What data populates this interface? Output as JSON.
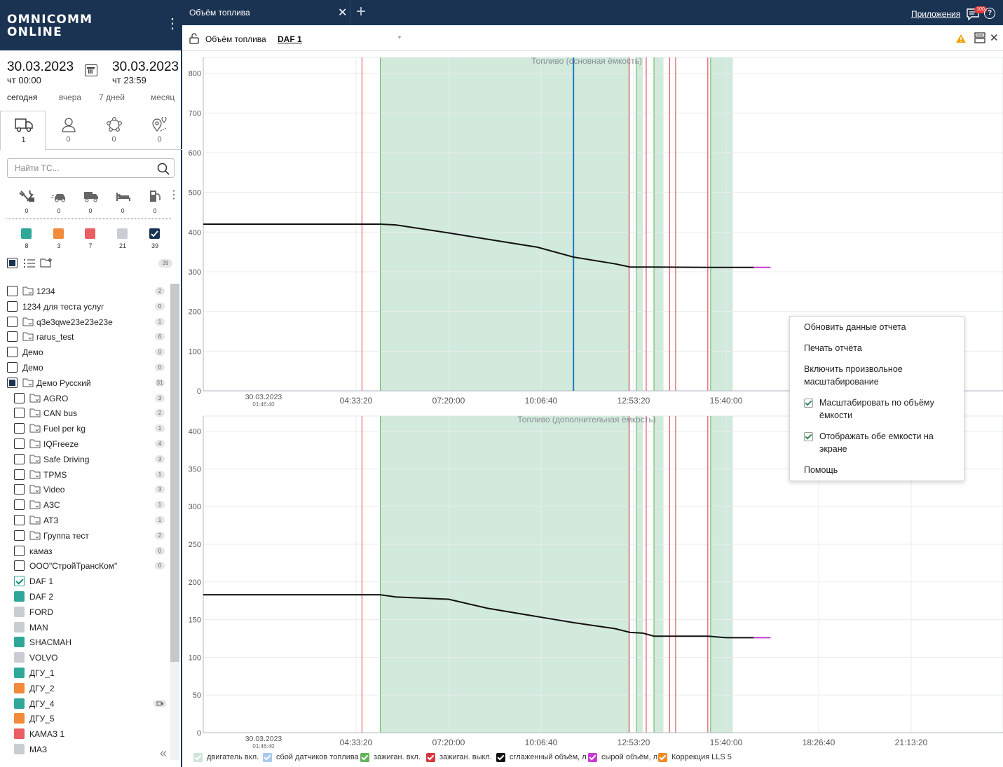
{
  "brand": {
    "line1": "OMNICOMM",
    "line2": "ONLINE"
  },
  "period": {
    "from_date": "30.03.2023",
    "from_time": "чт 00:00",
    "to_date": "30.03.2023",
    "to_time": "чт 23:59",
    "quick": [
      "сегодня",
      "вчера",
      "7 дней",
      "месяц"
    ]
  },
  "entity_tabs": [
    {
      "icon": "truck-icon",
      "count": "1"
    },
    {
      "icon": "user-icon",
      "count": "0"
    },
    {
      "icon": "network-icon",
      "count": "0"
    },
    {
      "icon": "geozone-icon",
      "count": "0"
    }
  ],
  "search": {
    "placeholder": "Найти ТС..."
  },
  "status_filters": [
    {
      "icon": "service-icon",
      "count": "0"
    },
    {
      "icon": "car-moving-icon",
      "count": "0"
    },
    {
      "icon": "truck-parked-icon",
      "count": "0"
    },
    {
      "icon": "bed-icon",
      "count": "0"
    },
    {
      "icon": "fuel-station-icon",
      "count": "0"
    }
  ],
  "color_filters": [
    {
      "color": "#2fa89a",
      "count": "8"
    },
    {
      "color": "#f28a3c",
      "count": "3"
    },
    {
      "color": "#ea5d62",
      "count": "7"
    },
    {
      "color": "#c9cdd3",
      "count": "21"
    },
    {
      "color": "#1b3352",
      "count": "39",
      "checked": true
    }
  ],
  "total_count": "39",
  "tree": [
    {
      "label": "1234",
      "count": "2",
      "folder": true,
      "level": 0,
      "state": "none"
    },
    {
      "label": "1234 для теста услуг",
      "count": "0",
      "folder": false,
      "level": 0,
      "state": "none"
    },
    {
      "label": "q3e3qwe23e23e23e",
      "count": "1",
      "folder": true,
      "level": 0,
      "state": "none"
    },
    {
      "label": "rarus_test",
      "count": "6",
      "folder": true,
      "level": 0,
      "state": "none"
    },
    {
      "label": "Демо",
      "count": "0",
      "folder": false,
      "level": 0,
      "state": "none"
    },
    {
      "label": "Демо",
      "count": "0",
      "folder": false,
      "level": 0,
      "state": "none"
    },
    {
      "label": "Демо Русский",
      "count": "31",
      "folder": true,
      "level": 0,
      "state": "partial"
    },
    {
      "label": "AGRO",
      "count": "3",
      "folder": true,
      "level": 1,
      "state": "none"
    },
    {
      "label": "CAN bus",
      "count": "2",
      "folder": true,
      "level": 1,
      "state": "none"
    },
    {
      "label": "Fuel per kg",
      "count": "1",
      "folder": true,
      "level": 1,
      "state": "none"
    },
    {
      "label": "IQFreeze",
      "count": "4",
      "folder": true,
      "level": 1,
      "state": "none"
    },
    {
      "label": "Safe Driving",
      "count": "3",
      "folder": true,
      "level": 1,
      "state": "none"
    },
    {
      "label": "TPMS",
      "count": "1",
      "folder": true,
      "level": 1,
      "state": "none"
    },
    {
      "label": "Video",
      "count": "3",
      "folder": true,
      "level": 1,
      "state": "none"
    },
    {
      "label": "АЗС",
      "count": "1",
      "folder": true,
      "level": 1,
      "state": "none"
    },
    {
      "label": "АТЗ",
      "count": "1",
      "folder": true,
      "level": 1,
      "state": "none"
    },
    {
      "label": "Группа тест",
      "count": "2",
      "folder": true,
      "level": 1,
      "state": "none"
    },
    {
      "label": "камаз",
      "count": "0",
      "folder": false,
      "level": 1,
      "state": "none"
    },
    {
      "label": "ООО\"СтройТрансКом\"",
      "count": "0",
      "folder": false,
      "level": 1,
      "state": "none"
    },
    {
      "label": "DAF 1",
      "color": "#2fa89a",
      "level": 1,
      "state": "checked"
    },
    {
      "label": "DAF 2",
      "color": "#2fa89a",
      "level": 1,
      "state": "color"
    },
    {
      "label": "FORD",
      "color": "#c9cdd3",
      "level": 1,
      "state": "color"
    },
    {
      "label": "MAN",
      "color": "#c9cdd3",
      "level": 1,
      "state": "color"
    },
    {
      "label": "SHACMAH",
      "color": "#2fa89a",
      "level": 1,
      "state": "color"
    },
    {
      "label": "VOLVO",
      "color": "#c9cdd3",
      "level": 1,
      "state": "color"
    },
    {
      "label": "ДГУ_1",
      "color": "#2fa89a",
      "level": 1,
      "state": "color"
    },
    {
      "label": "ДГУ_2",
      "color": "#f28a3c",
      "level": 1,
      "state": "color"
    },
    {
      "label": "ДГУ_4",
      "color": "#2fa89a",
      "level": 1,
      "state": "color",
      "video": true
    },
    {
      "label": "ДГУ_5",
      "color": "#f28a3c",
      "level": 1,
      "state": "color"
    },
    {
      "label": "КАМАЗ 1",
      "color": "#ea5d62",
      "level": 1,
      "state": "color"
    },
    {
      "label": "МАЗ",
      "color": "#c9cdd3",
      "level": 1,
      "state": "color"
    }
  ],
  "header": {
    "tab_title": "Объём топлива",
    "apps": "Приложения",
    "notifications": "100",
    "help": "?"
  },
  "report": {
    "name": "Объём топлива",
    "vehicle": "DAF 1"
  },
  "context_menu": [
    {
      "label": "Обновить данные отчета",
      "check": false
    },
    {
      "label": "Печать отчёта",
      "check": false
    },
    {
      "label": "Включить произвольное масштабирование",
      "check": false
    },
    {
      "label": "Масштабировать по объёму ёмкости",
      "check": true
    },
    {
      "label": "Отображать обе емкости на экране",
      "check": true
    },
    {
      "label": "Помощь",
      "check": false
    }
  ],
  "legend": [
    {
      "label": "двигатель вкл.",
      "color": "#cfe6d6"
    },
    {
      "label": "сбой датчиков топлива",
      "color": "#a9c9ee"
    },
    {
      "label": "зажиган. вкл.",
      "color": "#62b35a"
    },
    {
      "label": "зажиган. выкл.",
      "color": "#d9363e"
    },
    {
      "label": "сглаженный объём, л",
      "color": "#111111"
    },
    {
      "label": "сырой объём, л",
      "color": "#c93ad2"
    },
    {
      "label": "Коррекция LLS 5",
      "color": "#f08a24"
    }
  ],
  "chart_data": [
    {
      "type": "line",
      "title": "Топливо (основная ёмкость)",
      "x_start": {
        "date": "30.03.2023",
        "time": "01:46:40"
      },
      "x_ticks": [
        "04:33:20",
        "07:20:00",
        "10:06:40",
        "12:53:20",
        "15:40:00"
      ],
      "ylim": [
        0,
        840
      ],
      "y_ticks": [
        0,
        100,
        200,
        300,
        400,
        500,
        600,
        700,
        800
      ],
      "engine_on_intervals": [
        [
          "05:17",
          "12:47"
        ],
        [
          "12:58",
          "13:10"
        ],
        [
          "13:30",
          "13:47"
        ],
        [
          "15:12",
          "15:52"
        ]
      ],
      "ignition_off_events": [
        "04:44",
        "12:45",
        "13:16",
        "13:58",
        "14:09",
        "15:07"
      ],
      "ignition_on_events": [
        "05:17",
        "12:58",
        "13:30",
        "15:12"
      ],
      "cursor_time": "11:05",
      "series": [
        {
          "name": "сглаженный объём, л",
          "x": [
            "00:00",
            "04:43",
            "05:17",
            "05:45",
            "07:20",
            "08:30",
            "10:00",
            "11:05",
            "12:20",
            "12:47",
            "13:30",
            "15:07",
            "15:40",
            "16:30"
          ],
          "values": [
            420,
            420,
            420,
            418,
            398,
            382,
            362,
            337,
            320,
            312,
            312,
            311,
            311,
            311
          ]
        },
        {
          "name": "сырой объём, л",
          "x": [
            "16:30",
            "17:00"
          ],
          "values": [
            311,
            311
          ]
        }
      ]
    },
    {
      "type": "line",
      "title": "Топливо (дополнительная ёмкость)",
      "x_start": {
        "date": "30.03.2023",
        "time": "01:46:40"
      },
      "x_ticks": [
        "04:33:20",
        "07:20:00",
        "10:06:40",
        "12:53:20",
        "15:40:00",
        "18:26:40",
        "21:13:20"
      ],
      "ylim": [
        0,
        420
      ],
      "y_ticks": [
        0,
        50,
        100,
        150,
        200,
        250,
        300,
        350,
        400
      ],
      "series": [
        {
          "name": "сглаженный объём, л",
          "x": [
            "00:00",
            "04:43",
            "05:17",
            "05:45",
            "07:20",
            "08:30",
            "10:00",
            "11:05",
            "12:20",
            "12:47",
            "13:10",
            "13:30",
            "15:07",
            "15:40",
            "16:30"
          ],
          "values": [
            183,
            183,
            183,
            180,
            177,
            165,
            154,
            146,
            138,
            133,
            132,
            128,
            128,
            126,
            126
          ]
        },
        {
          "name": "сырой объём, л",
          "x": [
            "16:30",
            "17:00"
          ],
          "values": [
            126,
            126
          ]
        }
      ]
    }
  ]
}
